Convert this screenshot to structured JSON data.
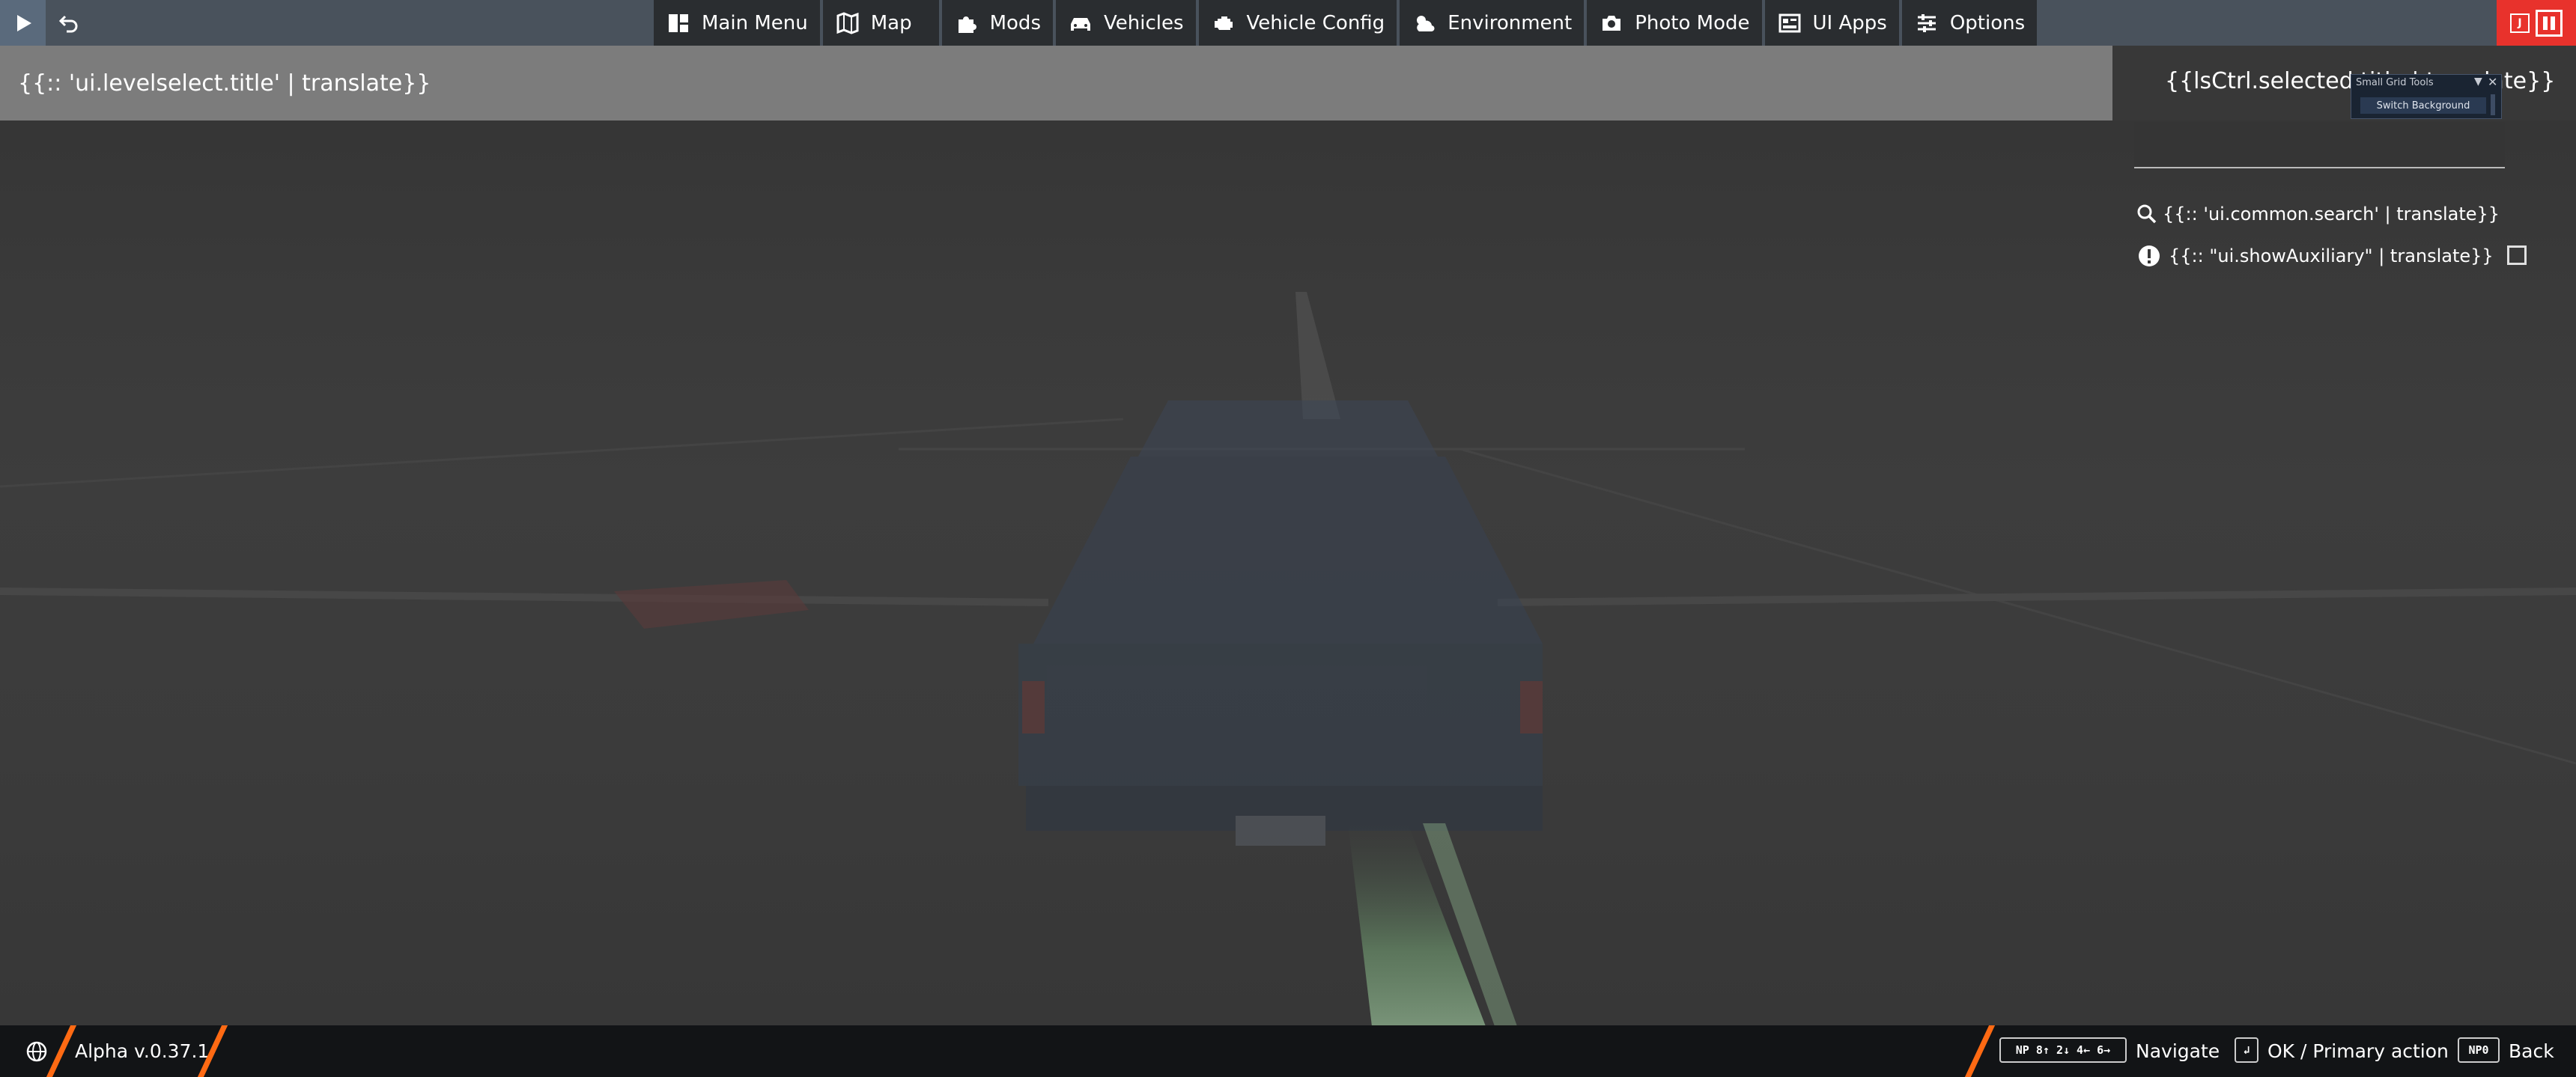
{
  "topbar": {
    "menu": [
      {
        "label": "Main Menu",
        "icon": "main-menu-icon"
      },
      {
        "label": "Map",
        "icon": "map-icon"
      },
      {
        "label": "Mods",
        "icon": "puzzle-icon"
      },
      {
        "label": "Vehicles",
        "icon": "car-icon"
      },
      {
        "label": "Vehicle Config",
        "icon": "engine-icon"
      },
      {
        "label": "Environment",
        "icon": "weather-icon"
      },
      {
        "label": "Photo Mode",
        "icon": "camera-icon"
      },
      {
        "label": "UI Apps",
        "icon": "apps-icon"
      },
      {
        "label": "Options",
        "icon": "sliders-icon"
      }
    ],
    "corner_left": [
      "play-icon",
      "undo-icon"
    ],
    "corner_right": {
      "small_label": "J",
      "icon": "pause-icon"
    }
  },
  "title": "{{:: 'ui.levelselect.title' | translate}}",
  "right_panel": {
    "selected_title": "{{lsCtrl.selected.title | translate}}",
    "search_placeholder": "{{:: 'ui.common.search' | translate}}",
    "aux_label": "{{:: \"ui.showAuxiliary\" | translate}}",
    "aux_checked": false
  },
  "small_grid_tools": {
    "title": "Small Grid Tools",
    "dropdown": "▼",
    "close": "✕",
    "button": "Switch Background"
  },
  "bottombar": {
    "version": "Alpha v.0.37.1",
    "hints": [
      {
        "key": "NP 8↑ 2↓ 4← 6→",
        "label": "Navigate"
      },
      {
        "key": "↲",
        "label": "OK / Primary action"
      },
      {
        "key": "NP0",
        "label": "Back"
      }
    ]
  },
  "colors": {
    "accent": "#ff6a13",
    "topbar": "#49525c",
    "menu_item": "#2a2d30",
    "pause_red": "#e8322c"
  }
}
